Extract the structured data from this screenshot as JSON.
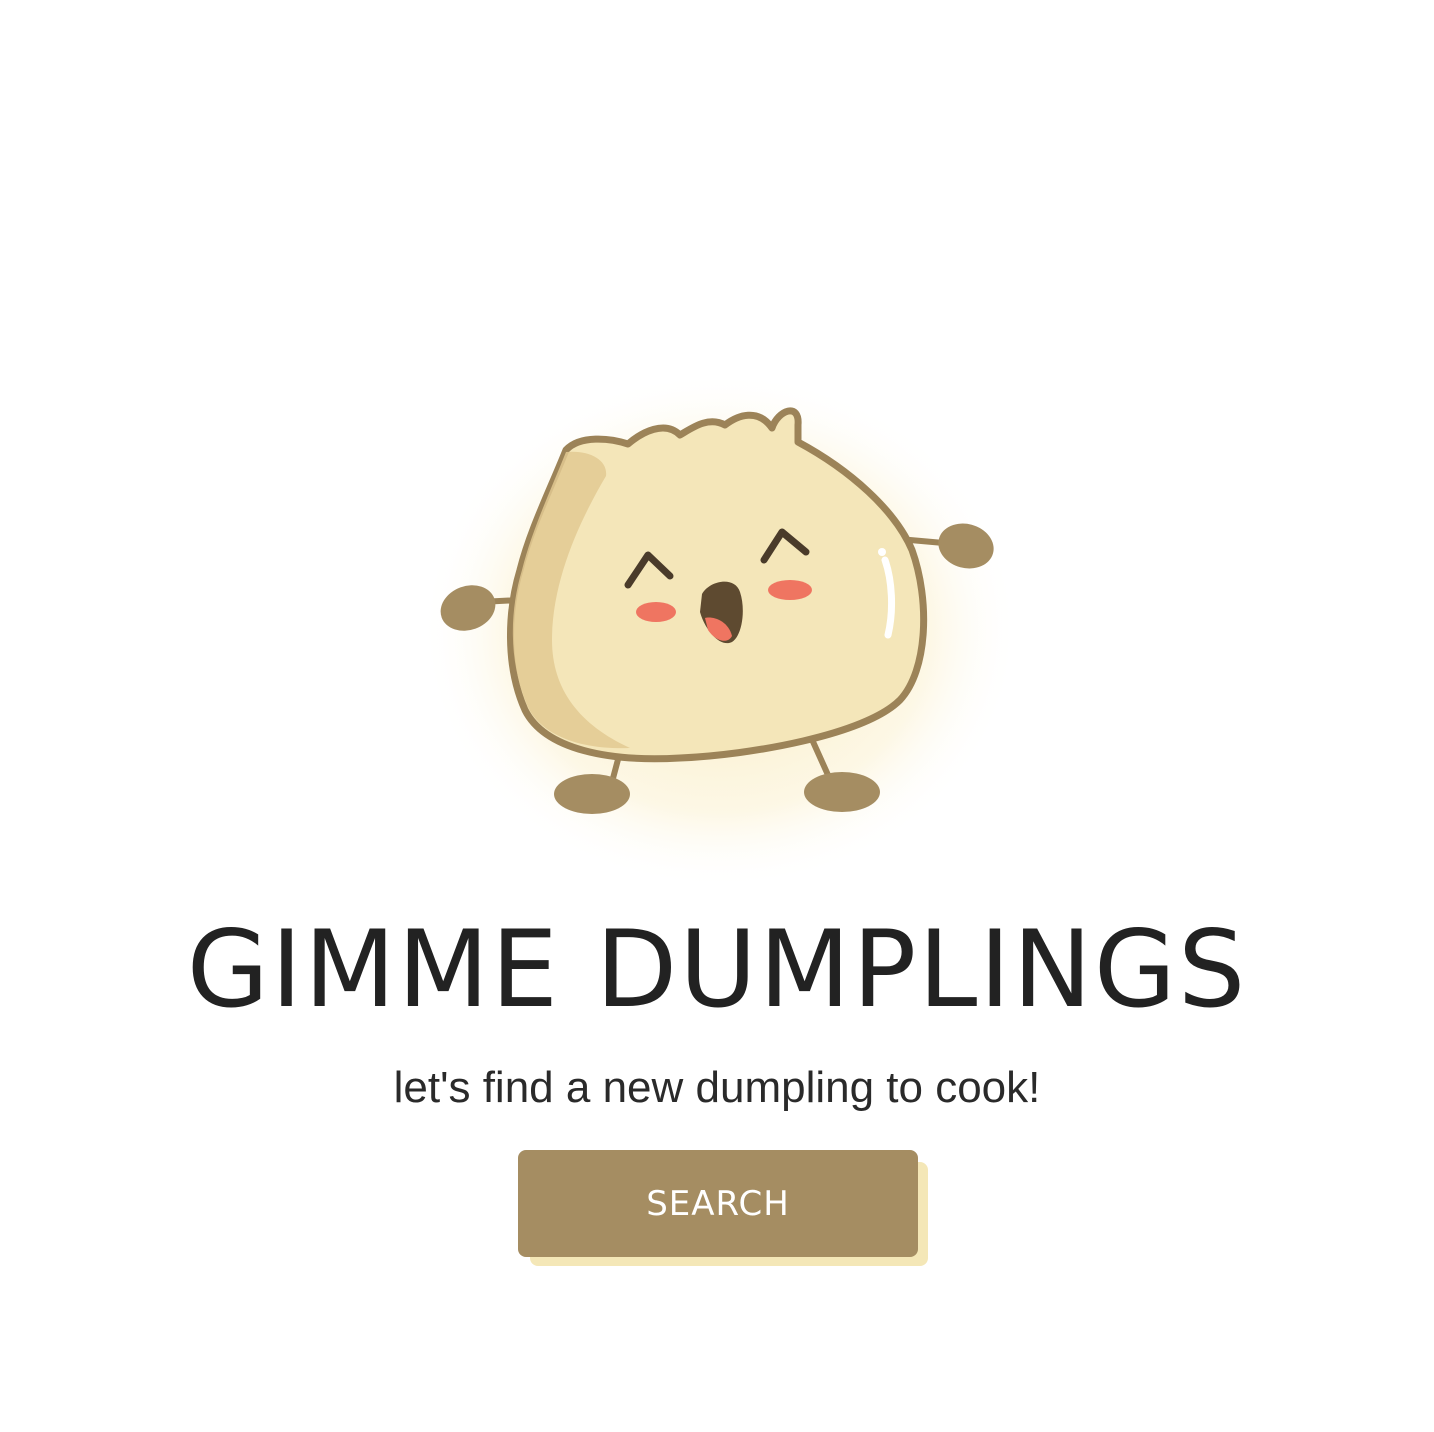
{
  "hero": {
    "mascot_icon": "dumpling-mascot-icon",
    "title": "GIMME DUMPLINGS",
    "subtitle": "let's find a new dumpling to cook!",
    "search_label": "SEARCH"
  },
  "colors": {
    "button": "#a58d62",
    "button_shadow": "#f4e7b7",
    "dumpling_fill": "#f4e6b9",
    "dumpling_outline": "#9c8358",
    "cheek": "#ef7561",
    "title_text": "#222222"
  }
}
